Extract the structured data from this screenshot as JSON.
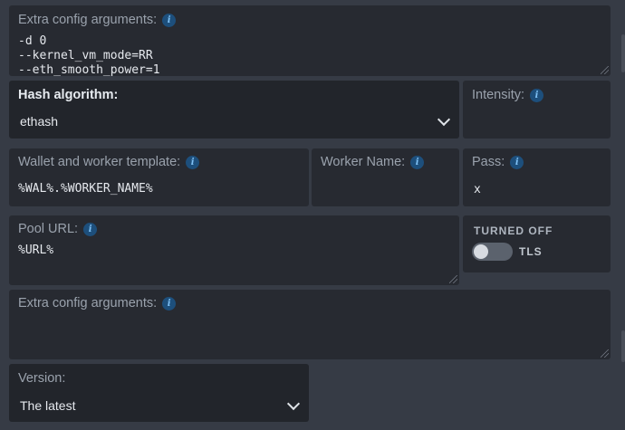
{
  "extra_config_1": {
    "label": "Extra config arguments:",
    "lines": [
      "-d 0",
      "--kernel_vm_mode=RR",
      "--eth_smooth_power=1"
    ]
  },
  "hash_algorithm": {
    "label": "Hash algorithm:",
    "value": "ethash"
  },
  "intensity": {
    "label": "Intensity:"
  },
  "wallet_template": {
    "label": "Wallet and worker template:",
    "value": "%WAL%.%WORKER_NAME%"
  },
  "worker_name": {
    "label": "Worker Name:"
  },
  "pass": {
    "label": "Pass:",
    "value": "x"
  },
  "pool_url": {
    "label": "Pool URL:",
    "value": "%URL%"
  },
  "tls": {
    "state_label": "TURNED OFF",
    "label": "TLS",
    "enabled": false
  },
  "extra_config_2": {
    "label": "Extra config arguments:",
    "value": ""
  },
  "version": {
    "label": "Version:",
    "value": "The latest"
  },
  "info_glyph": "i",
  "colors": {
    "info_badge": "#1d4f7c",
    "panel": "#272a31",
    "background": "#363b45"
  }
}
